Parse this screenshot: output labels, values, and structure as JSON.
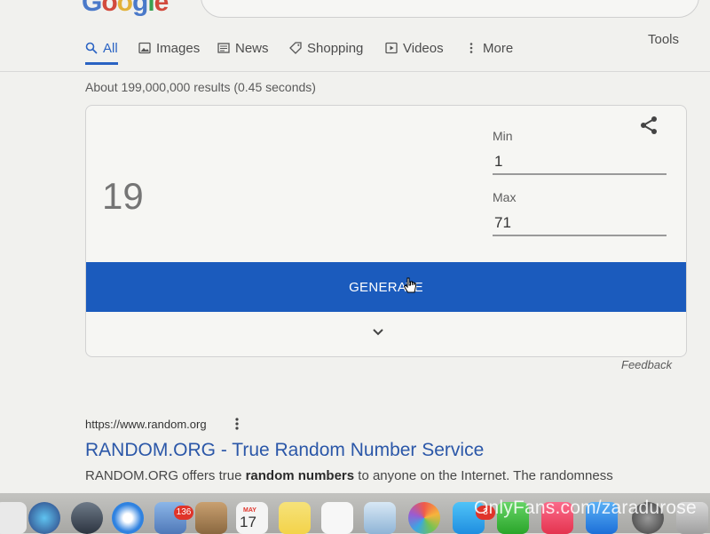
{
  "header": {
    "logo_text": "Google"
  },
  "tabs": [
    {
      "label": "All",
      "icon": "search-icon",
      "active": true
    },
    {
      "label": "Images",
      "icon": "image-icon"
    },
    {
      "label": "News",
      "icon": "news-icon"
    },
    {
      "label": "Shopping",
      "icon": "tag-icon"
    },
    {
      "label": "Videos",
      "icon": "play-icon"
    },
    {
      "label": "More",
      "icon": "more-vertical-icon"
    }
  ],
  "tools_label": "Tools",
  "results_info": "About 199,000,000 results (0.45 seconds)",
  "rng": {
    "result": "19",
    "min_label": "Min",
    "min_value": "1",
    "max_label": "Max",
    "max_value": "71",
    "generate_label": "GENERATE",
    "share_icon": "share-icon",
    "expand_icon": "chevron-down-icon"
  },
  "feedback_label": "Feedback",
  "result_item": {
    "url": "https://www.random.org",
    "title": "RANDOM.ORG - True Random Number Service",
    "snippet_before": "RANDOM.ORG offers true ",
    "snippet_bold": "random numbers",
    "snippet_after": " to anyone on the Internet. The randomness"
  },
  "dock": {
    "mail_badge": "136",
    "calendar_month": "MAY",
    "calendar_day": "17",
    "notif_badge": "3"
  },
  "watermark": "OnlyFans.com/zaradurose",
  "colors": {
    "accent": "#1b5bbd",
    "link": "#2b57a8",
    "active_tab": "#2a63c3"
  }
}
